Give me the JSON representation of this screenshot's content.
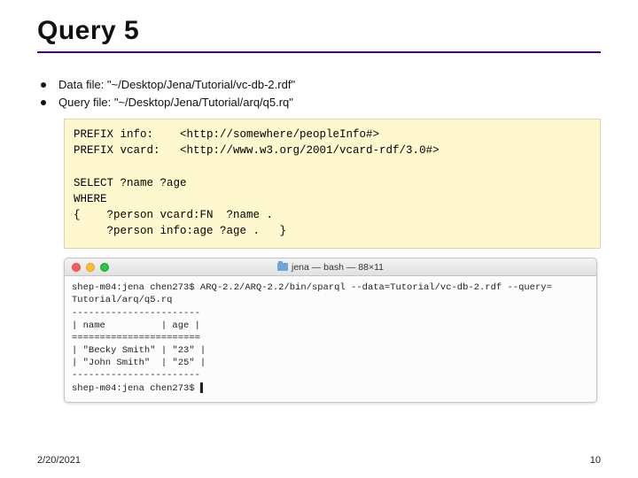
{
  "title": "Query 5",
  "bullets": [
    "Data file: \"~/Desktop/Jena/Tutorial/vc-db-2.rdf\"",
    "Query file: \"~/Desktop/Jena/Tutorial/arq/q5.rq\""
  ],
  "code": "PREFIX info:    <http://somewhere/peopleInfo#>\nPREFIX vcard:   <http://www.w3.org/2001/vcard-rdf/3.0#>\n\nSELECT ?name ?age\nWHERE\n{    ?person vcard:FN  ?name .\n     ?person info:age ?age .   }",
  "terminal": {
    "title": "jena — bash — 88×11",
    "body": "shep-m04:jena chen273$ ARQ-2.2/ARQ-2.2/bin/sparql --data=Tutorial/vc-db-2.rdf --query=\nTutorial/arq/q5.rq\n-----------------------\n| name          | age |\n=======================\n| \"Becky Smith\" | \"23\" |\n| \"John Smith\"  | \"25\" |\n-----------------------\nshep-m04:jena chen273$ ▌"
  },
  "footer": {
    "date": "2/20/2021",
    "page": "10"
  }
}
